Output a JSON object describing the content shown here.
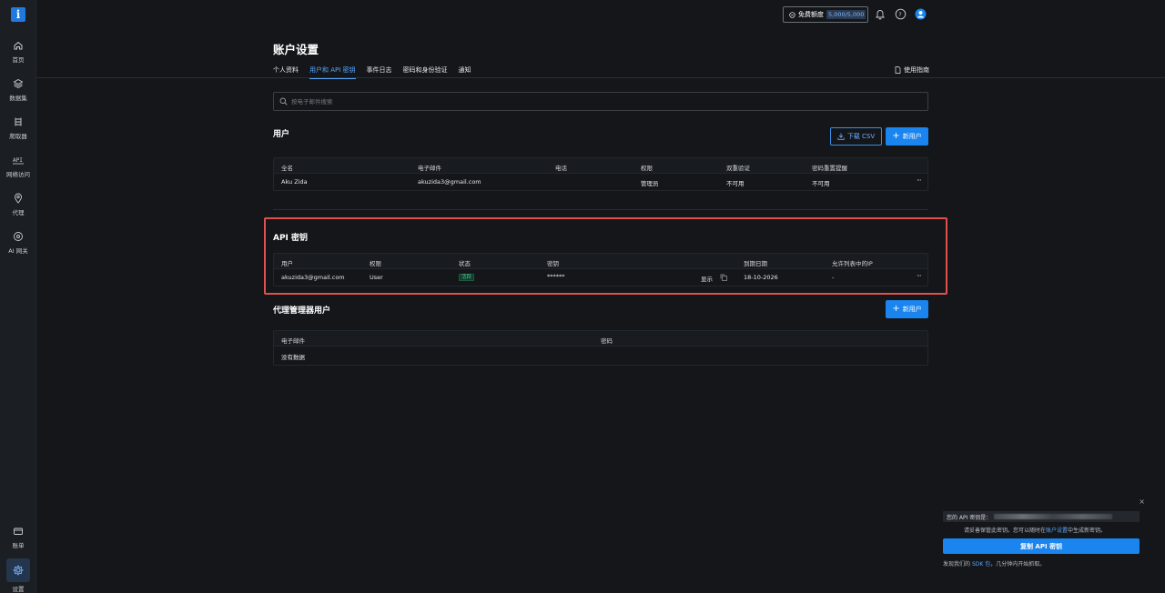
{
  "sidebar": {
    "logo": "i",
    "items": [
      {
        "label": "首页",
        "icon": "home-icon"
      },
      {
        "label": "数据集",
        "icon": "dataset-icon"
      },
      {
        "label": "爬取器",
        "icon": "scraper-icon"
      },
      {
        "label": "网络访问",
        "icon": "api-icon"
      },
      {
        "label": "代理",
        "icon": "location-icon"
      },
      {
        "label": "AI 网关",
        "icon": "ai-gateway-icon"
      }
    ],
    "bottom_items": [
      {
        "label": "账单",
        "icon": "billing-icon"
      },
      {
        "label": "设置",
        "icon": "settings-icon",
        "active": true
      }
    ]
  },
  "topbar": {
    "quota_label": "免费额度",
    "quota_value": "5,000/5,000"
  },
  "page": {
    "title": "账户设置",
    "tabs": [
      "个人资料",
      "用户和 API 密钥",
      "事件日志",
      "密码和身份验证",
      "通知"
    ],
    "active_tab": "用户和 API 密钥",
    "guide": "使用指南"
  },
  "search": {
    "placeholder": "按电子邮件搜索"
  },
  "users": {
    "title": "用户",
    "download_csv": "下载 CSV",
    "new_user": "新用户",
    "headers": [
      "全名",
      "电子邮件",
      "电话",
      "权限",
      "双重验证",
      "密码重置提醒"
    ],
    "rows": [
      {
        "name": "Aku Zida",
        "email": "akuzida3@gmail.com",
        "phone": "",
        "role": "管理员",
        "two_factor": "不可用",
        "reset": "不可用"
      }
    ]
  },
  "api_keys": {
    "title": "API 密钥",
    "headers": [
      "用户",
      "权限",
      "状态",
      "密钥",
      "到期日期",
      "允许列表中的IP"
    ],
    "rows": [
      {
        "user": "akuzida3@gmail.com",
        "role": "User",
        "status": "活跃",
        "key": "******",
        "show": "显示",
        "expiry": "18-10-2026",
        "ips": "-"
      }
    ]
  },
  "proxy_users": {
    "title": "代理管理器用户",
    "new_user": "新用户",
    "headers": [
      "电子邮件",
      "密码"
    ],
    "empty": "没有数据"
  },
  "toast": {
    "key_label": "您的 API 密钥是：",
    "note_prefix": "请妥善保管此密钥。您可以随时在",
    "note_link": "账户设置",
    "note_suffix": "中生成新密钥。",
    "copy_button": "复制 API 密钥",
    "foot_prefix": "发现我们的",
    "foot_link": "SDK 包",
    "foot_suffix": "，几分钟内开始抓取。"
  },
  "colors": {
    "accent": "#1a84ef",
    "highlight": "#e0504c",
    "active_badge": "#4fc38a"
  }
}
